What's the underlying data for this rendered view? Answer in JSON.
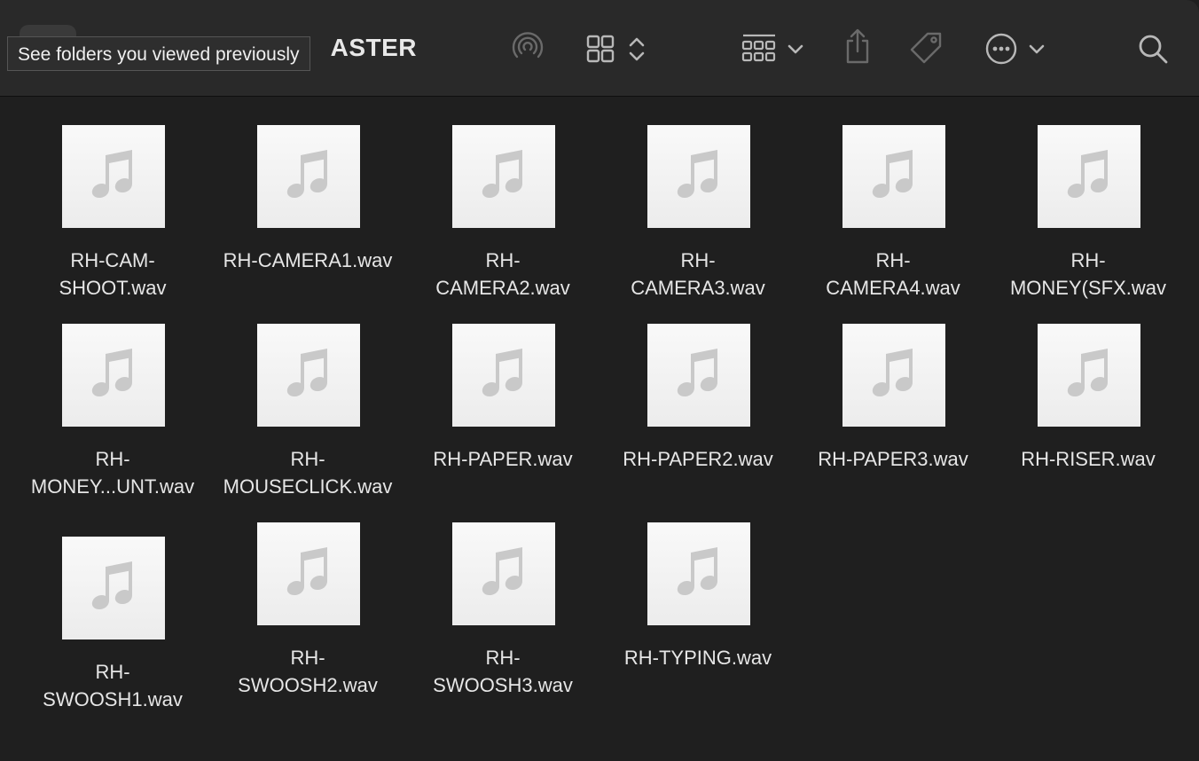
{
  "window": {
    "folder_title": "ASTER",
    "tooltip": "See folders you viewed previously"
  },
  "toolbar": {
    "icons": [
      "airdrop-icon",
      "view-grid-icon",
      "group-icon",
      "share-icon",
      "tag-icon",
      "more-icon",
      "search-icon"
    ]
  },
  "files": [
    {
      "line1": "RH-CAM-",
      "line2": "SHOOT.wav"
    },
    {
      "line1": "RH-CAMERA1.wav",
      "line2": ""
    },
    {
      "line1": "RH-",
      "line2": "CAMERA2.wav"
    },
    {
      "line1": "RH-",
      "line2": "CAMERA3.wav"
    },
    {
      "line1": "RH-",
      "line2": "CAMERA4.wav"
    },
    {
      "line1": "RH-",
      "line2": "MONEY(SFX.wav"
    },
    {
      "line1": "RH-",
      "line2": "MONEY...UNT.wav"
    },
    {
      "line1": "RH-",
      "line2": "MOUSECLICK.wav"
    },
    {
      "line1": "RH-PAPER.wav",
      "line2": ""
    },
    {
      "line1": "RH-PAPER2.wav",
      "line2": ""
    },
    {
      "line1": "RH-PAPER3.wav",
      "line2": ""
    },
    {
      "line1": "RH-RISER.wav",
      "line2": ""
    },
    {
      "line1": "RH-",
      "line2": "SWOOSH1.wav"
    },
    {
      "line1": "RH-",
      "line2": "SWOOSH2.wav"
    },
    {
      "line1": "RH-",
      "line2": "SWOOSH3.wav"
    },
    {
      "line1": "RH-TYPING.wav",
      "line2": ""
    }
  ]
}
